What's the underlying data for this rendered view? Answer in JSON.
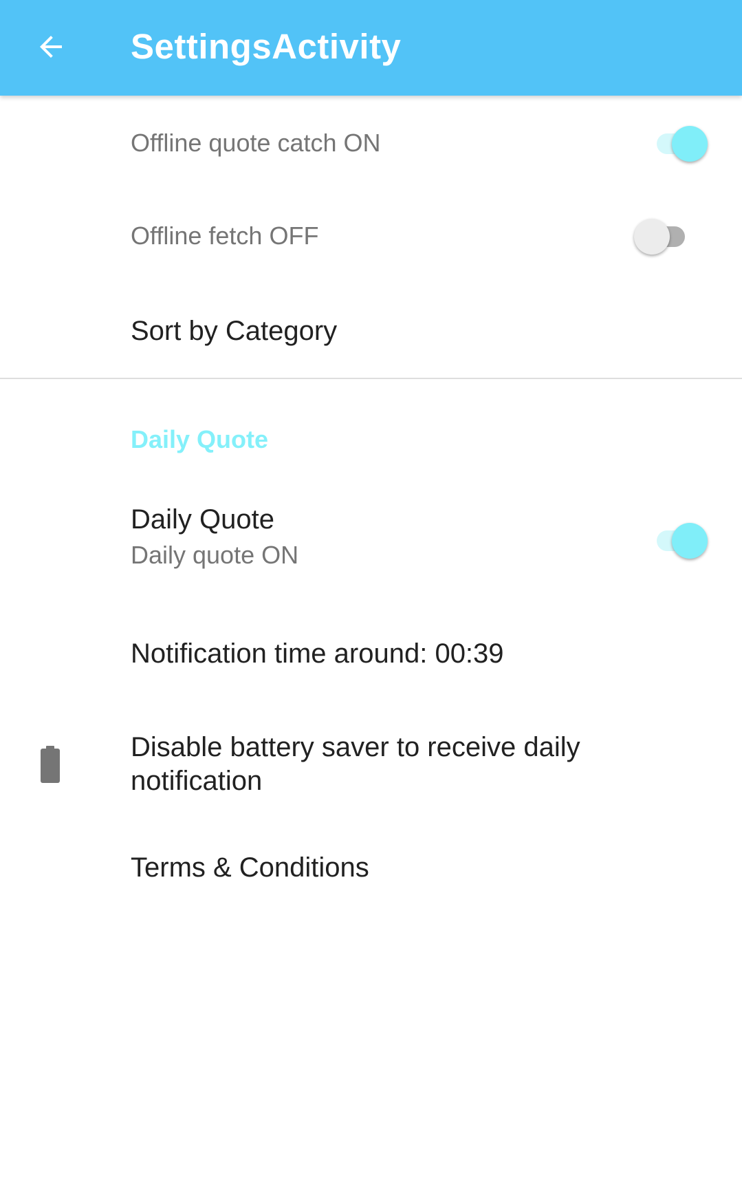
{
  "app_bar": {
    "title": "SettingsActivity",
    "back_icon": "arrow-back-icon",
    "background_color": "#52c3f7"
  },
  "preferences": [
    {
      "summary": "Offline quote catch ON",
      "switch_on": true
    },
    {
      "summary": "Offline fetch OFF",
      "switch_on": false
    },
    {
      "title": "Sort by Category"
    }
  ],
  "daily_quote_section": {
    "category_title": "Daily Quote",
    "category_color": "#84f0fa",
    "daily_quote": {
      "title": "Daily Quote",
      "summary": "Daily quote ON",
      "switch_on": true
    },
    "notification_time": {
      "title": "Notification time around: 00:39"
    },
    "battery_saver": {
      "icon": "battery-icon",
      "title_line1": "Disable battery saver to receive daily",
      "title_line2": "notification"
    },
    "terms": {
      "title": "Terms & Conditions"
    }
  },
  "colors": {
    "switch_on_thumb": "#80eef9",
    "switch_on_track": "#d4f8fb",
    "switch_off_thumb": "#ececec",
    "switch_off_track": "#b0b0b0"
  }
}
